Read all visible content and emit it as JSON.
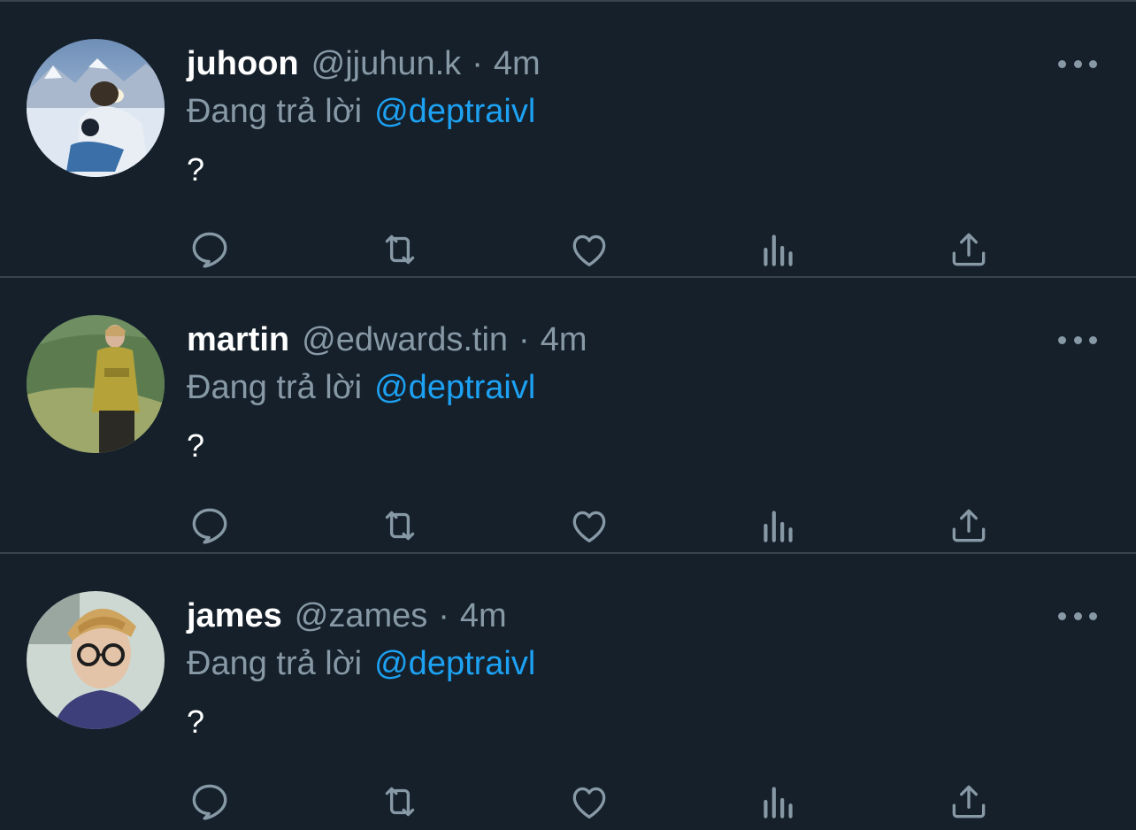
{
  "colors": {
    "background": "#15202b",
    "divider": "#38444d",
    "secondary_text": "#8899a6",
    "mention": "#1da1f2",
    "primary_text": "#ffffff"
  },
  "tweets": [
    {
      "name": "juhoon",
      "handle": "@jjuhun.k",
      "separator": "·",
      "time": "4m",
      "reply_prefix": "Đang trả lời",
      "reply_to": "@deptraivl",
      "text": "?",
      "avatar": "snowy-mountain-photo"
    },
    {
      "name": "martin",
      "handle": "@edwards.tin",
      "separator": "·",
      "time": "4m",
      "reply_prefix": "Đang trả lời",
      "reply_to": "@deptraivl",
      "text": "?",
      "avatar": "green-hillside-photo"
    },
    {
      "name": "james",
      "handle": "@zames",
      "separator": "·",
      "time": "4m",
      "reply_prefix": "Đang trả lời",
      "reply_to": "@deptraivl",
      "text": "?",
      "avatar": "cap-and-glasses-photo"
    }
  ],
  "action_icons": [
    "reply-icon",
    "retweet-icon",
    "like-icon",
    "analytics-icon",
    "share-icon"
  ]
}
